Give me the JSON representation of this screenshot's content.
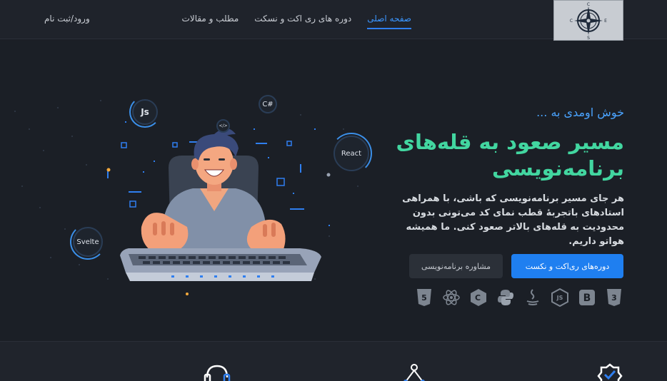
{
  "nav": {
    "items": [
      {
        "label": "صفحه اصلی",
        "active": true
      },
      {
        "label": "دوره های ری اکت و نسکت",
        "active": false
      },
      {
        "label": "مطلب و مقالات",
        "active": false
      }
    ],
    "login_label": "ورود/ثبت نام",
    "logo_letters": {
      "n": "C",
      "w": "C",
      "e": "E",
      "s": "S"
    }
  },
  "hero": {
    "welcome": "خوش اومدی به ...",
    "headline_line1": "مسیر صعود به قله‌های",
    "headline_line2": "برنامه‌نویسی",
    "description": "هر جای مسیر برنامه‌نویسی که باشی، با همراهی استادهای باتجربهٔ قطب نمای کد می‌تونی بدون محدودیت به قله‌های بالاتر صعود کنی. ما همیشه هواتو داریم.",
    "primary_button": "دوره‌های ری‌اکت و نکست",
    "secondary_button": "مشاوره برنامه‌نویسی"
  },
  "illustration": {
    "badges": [
      "Js",
      "C#",
      "React",
      "Svelte",
      "</>"
    ]
  },
  "tech_icons": [
    {
      "name": "css3-icon",
      "label": "3"
    },
    {
      "name": "bootstrap-icon",
      "label": "B"
    },
    {
      "name": "nodejs-icon",
      "label": "JS"
    },
    {
      "name": "java-icon",
      "label": ""
    },
    {
      "name": "python-icon",
      "label": ""
    },
    {
      "name": "csharp-icon",
      "label": "C"
    },
    {
      "name": "react-icon",
      "label": ""
    },
    {
      "name": "html5-icon",
      "label": "5"
    }
  ],
  "colors": {
    "accent": "#1f7ff0",
    "headline": "#42d6a0",
    "welcome": "#4aa3ff",
    "background": "#1b1f26"
  }
}
